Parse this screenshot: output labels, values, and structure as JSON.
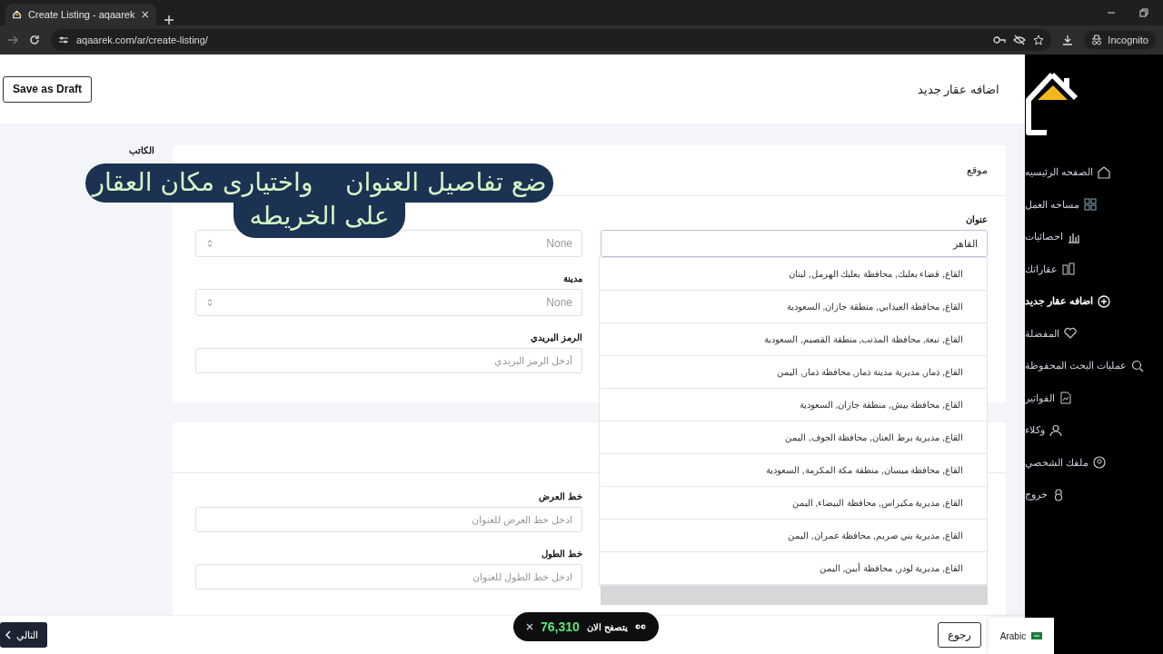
{
  "browser": {
    "tab_title": "Create Listing - aqaarek",
    "url": "aqaarek.com/ar/create-listing/",
    "incognito_label": "Incognito"
  },
  "header": {
    "save_draft": "Save as Draft",
    "title": "اضافه عقار جديد"
  },
  "sidebar": {
    "items": [
      {
        "label": "الصفحه الرئيسيه",
        "kind": "home",
        "selected": false
      },
      {
        "label": "مساحه العمل",
        "kind": "grid",
        "selected": false
      },
      {
        "label": "احصائيات",
        "kind": "chart",
        "selected": false
      },
      {
        "label": "عقاراتك",
        "kind": "building",
        "selected": false
      },
      {
        "label": "اضافه عقار جديد",
        "kind": "plus",
        "selected": true
      },
      {
        "label": "المفضلة",
        "kind": "heart",
        "selected": false
      },
      {
        "label": "عمليات البحث المحفوظة",
        "kind": "search",
        "selected": false
      },
      {
        "label": "الفواتير",
        "kind": "doc",
        "selected": false
      },
      {
        "label": "وكلاء",
        "kind": "user",
        "selected": false
      },
      {
        "label": "ملفك الشخصي",
        "kind": "profile",
        "selected": false
      },
      {
        "label": "خروج",
        "kind": "lock",
        "selected": false
      }
    ]
  },
  "author_label": "الكاتب",
  "location": {
    "title": "موقع",
    "address_label": "عنوان",
    "address_value": "القاهر",
    "suggestions": [
      "القاع, قضاء بعلبك, محافظة بعلبك الهرمل, لبنان",
      "القاع, محافظة العيدابي, منطقة جازان, السعودية",
      "القاع, نبعة, محافظة المذنب, منطقة القصيم, السعودية",
      "القاع, ذمار, مديرية مدينة ذمار, محافظة ذمار, اليمن",
      "القاع, محافظة بيش, منطقة جازان, السعودية",
      "القاع, مديرية برط العنان, محافظة الجوف, اليمن",
      "القاع, محافظة ميسان, منطقة مكة المكرمة, السعودية",
      "القاع, مديرية مكيراس, محافظة البيضاء, اليمن",
      "القاع, مديرية بني صريم, محافظة عمران, اليمن",
      "القاع, مديرية لودر, محافظة أبين, اليمن"
    ],
    "country_value": "None",
    "city_label": "مدينة",
    "city_value": "None",
    "postal_label": "الرمز البريدي",
    "postal_placeholder": "أدخل الرمز البريدي"
  },
  "coordinates": {
    "lat_label": "خط العرض",
    "lat_placeholder": "ادخل خط العرض للعنوان",
    "lng_label": "خط الطول",
    "lng_placeholder": "ادخل خط الطول للعنوان"
  },
  "caption": {
    "lines": [
      "ضع تفاصيل العنوان    واختيارى مكان العقار",
      "على الخريطه"
    ]
  },
  "bottom": {
    "next": "التالي",
    "back": "رجوع",
    "live_label": "يتصفح الان",
    "live_count": "76,310",
    "language": "Arabic"
  }
}
